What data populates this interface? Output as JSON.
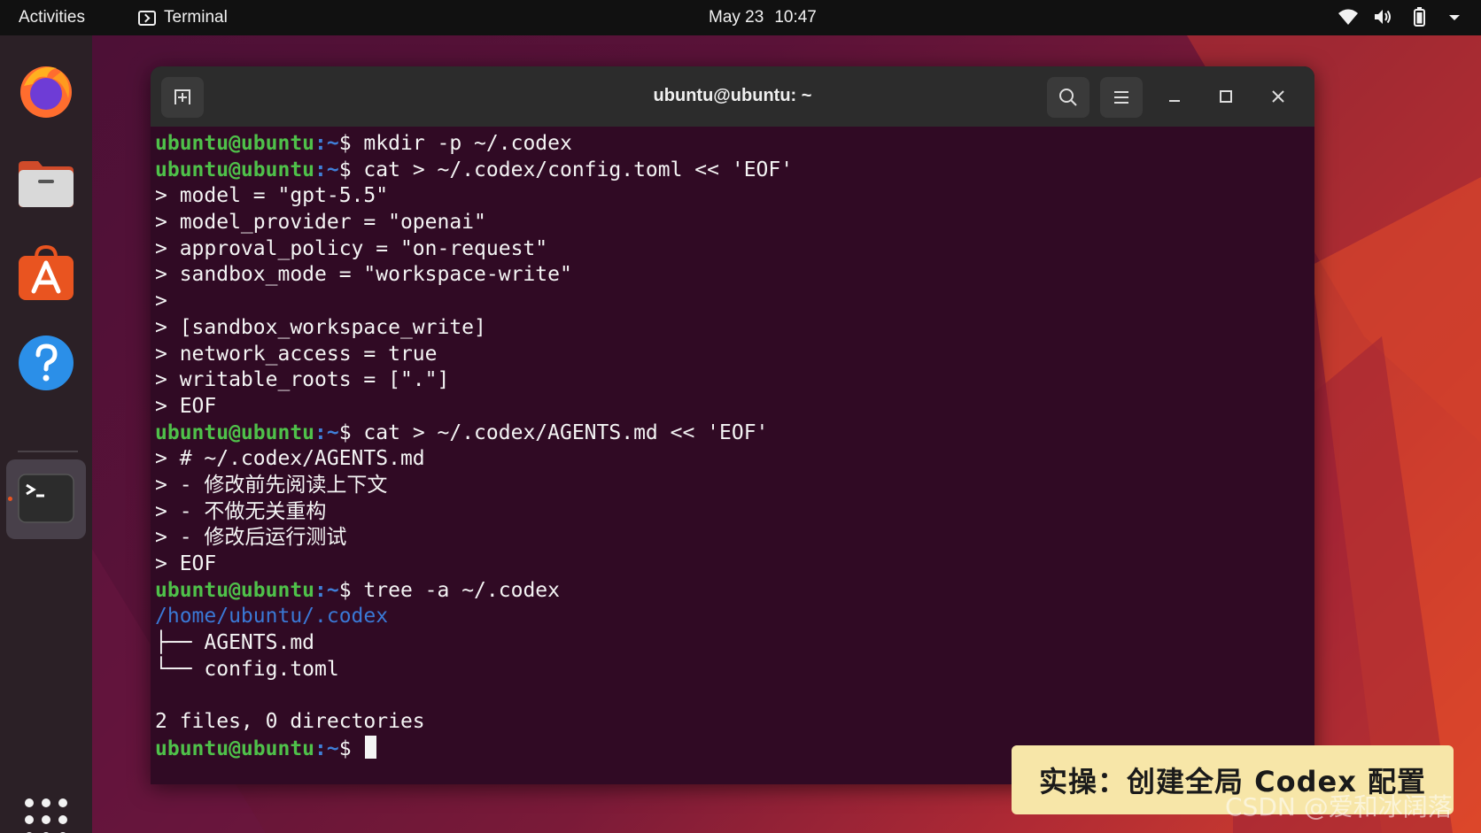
{
  "topbar": {
    "activities": "Activities",
    "app_name": "Terminal",
    "date": "May 23",
    "time": "10:47",
    "tray_icons": [
      "wifi-icon",
      "volume-icon",
      "battery-icon",
      "chevron-down-icon"
    ]
  },
  "dock": {
    "apps": [
      "firefox",
      "files",
      "app-center",
      "help",
      "terminal"
    ],
    "active_app": "terminal",
    "show_apps_icon": "grid-icon"
  },
  "window": {
    "title": "ubuntu@ubuntu: ~",
    "buttons": [
      "new-tab-icon",
      "search-icon",
      "menu-icon",
      "minimize-icon",
      "maximize-icon",
      "close-icon"
    ]
  },
  "terminal": {
    "prompt_user": "ubuntu@ubuntu",
    "prompt_path": ":~",
    "prompt_symbol": "$",
    "lines": [
      {
        "type": "prompt",
        "cmd": " mkdir -p ~/.codex"
      },
      {
        "type": "prompt",
        "cmd": " cat > ~/.codex/config.toml << 'EOF'"
      },
      {
        "type": "text",
        "text": "> model = \"gpt-5.5\""
      },
      {
        "type": "text",
        "text": "> model_provider = \"openai\""
      },
      {
        "type": "text",
        "text": "> approval_policy = \"on-request\""
      },
      {
        "type": "text",
        "text": "> sandbox_mode = \"workspace-write\""
      },
      {
        "type": "text",
        "text": ">"
      },
      {
        "type": "text",
        "text": "> [sandbox_workspace_write]"
      },
      {
        "type": "text",
        "text": "> network_access = true"
      },
      {
        "type": "text",
        "text": "> writable_roots = [\".\"]"
      },
      {
        "type": "text",
        "text": "> EOF"
      },
      {
        "type": "prompt",
        "cmd": " cat > ~/.codex/AGENTS.md << 'EOF'"
      },
      {
        "type": "text",
        "text": "> # ~/.codex/AGENTS.md"
      },
      {
        "type": "text",
        "text": "> - 修改前先阅读上下文"
      },
      {
        "type": "text",
        "text": "> - 不做无关重构"
      },
      {
        "type": "text",
        "text": "> - 修改后运行测试"
      },
      {
        "type": "text",
        "text": "> EOF"
      },
      {
        "type": "prompt",
        "cmd": " tree -a ~/.codex"
      },
      {
        "type": "dir",
        "text": "/home/ubuntu/.codex"
      },
      {
        "type": "text",
        "text": "├── AGENTS.md"
      },
      {
        "type": "text",
        "text": "└── config.toml"
      },
      {
        "type": "text",
        "text": ""
      },
      {
        "type": "text",
        "text": "2 files, 0 directories"
      },
      {
        "type": "prompt-cursor",
        "cmd": " "
      }
    ]
  },
  "caption": "实操：创建全局 Codex 配置",
  "watermark": "CSDN @爱和冰阔落"
}
